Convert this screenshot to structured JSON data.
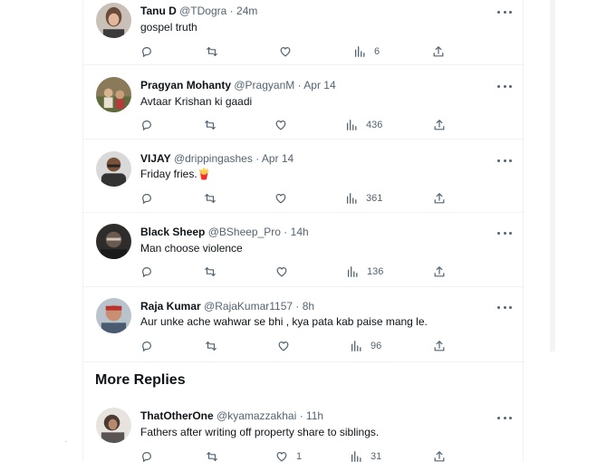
{
  "colors": {
    "text": "#0f1419",
    "secondary": "#536471",
    "divider": "#eff3f4"
  },
  "icons": {
    "reply": "reply-icon",
    "retweet": "retweet-icon",
    "like": "heart-icon",
    "views": "views-icon",
    "share": "share-icon",
    "more": "more-icon"
  },
  "tweets": [
    {
      "name": "Tanu D",
      "handle": "@TDogra",
      "sep": "·",
      "time": "24m",
      "text": "gospel truth",
      "reply_count": "",
      "retweet_count": "",
      "like_count": "",
      "views": "6"
    },
    {
      "name": "Pragyan Mohanty",
      "handle": "@PragyanM",
      "sep": "·",
      "time": "Apr 14",
      "text": "Avtaar Krishan ki gaadi",
      "reply_count": "",
      "retweet_count": "",
      "like_count": "",
      "views": "436"
    },
    {
      "name": "VIJAY",
      "handle": "@drippingashes",
      "sep": "·",
      "time": "Apr 14",
      "text": "Friday fries.",
      "emoji": "🍟",
      "reply_count": "",
      "retweet_count": "",
      "like_count": "",
      "views": "361"
    },
    {
      "name": "Black Sheep",
      "handle": "@BSheep_Pro",
      "sep": "·",
      "time": "14h",
      "text": "Man choose violence",
      "reply_count": "",
      "retweet_count": "",
      "like_count": "",
      "views": "136"
    },
    {
      "name": "Raja Kumar",
      "handle": "@RajaKumar1157",
      "sep": "·",
      "time": "8h",
      "text": "Aur unke ache wahwar se bhi , kya pata kab paise mang le.",
      "reply_count": "",
      "retweet_count": "",
      "like_count": "",
      "views": "96"
    }
  ],
  "more_replies": {
    "title": "More Replies",
    "tweets": [
      {
        "name": "ThatOtherOne",
        "handle": "@kyamazzakhai",
        "sep": "·",
        "time": "11h",
        "text": "Fathers after writing off property share to siblings.",
        "reply_count": "",
        "retweet_count": "",
        "like_count": "1",
        "views": "31"
      }
    ]
  }
}
